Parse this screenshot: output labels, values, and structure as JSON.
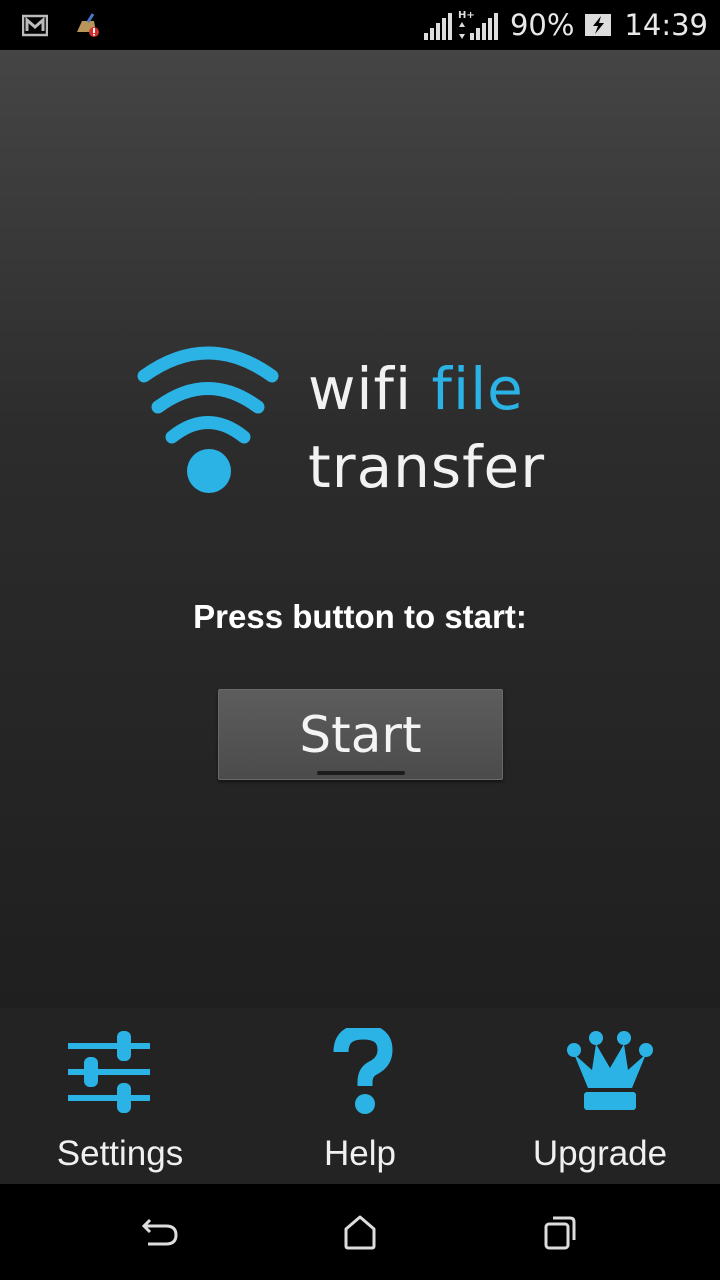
{
  "status_bar": {
    "battery": "90%",
    "time": "14:39",
    "network": "H+",
    "icons": [
      "gmail-icon",
      "cleaner-app-icon",
      "signal-icon",
      "battery-charging-icon"
    ]
  },
  "logo": {
    "word1": "wifi",
    "word2": "file",
    "word3": "transfer",
    "accent_color": "#2bb3e6"
  },
  "main": {
    "prompt": "Press button to start:",
    "start_label": "Start"
  },
  "toolbar": {
    "items": [
      {
        "label": "Settings",
        "icon": "sliders-icon"
      },
      {
        "label": "Help",
        "icon": "question-mark-icon"
      },
      {
        "label": "Upgrade",
        "icon": "crown-icon"
      }
    ]
  },
  "navbar": {
    "icons": [
      "back-icon",
      "home-icon",
      "recents-icon"
    ]
  }
}
